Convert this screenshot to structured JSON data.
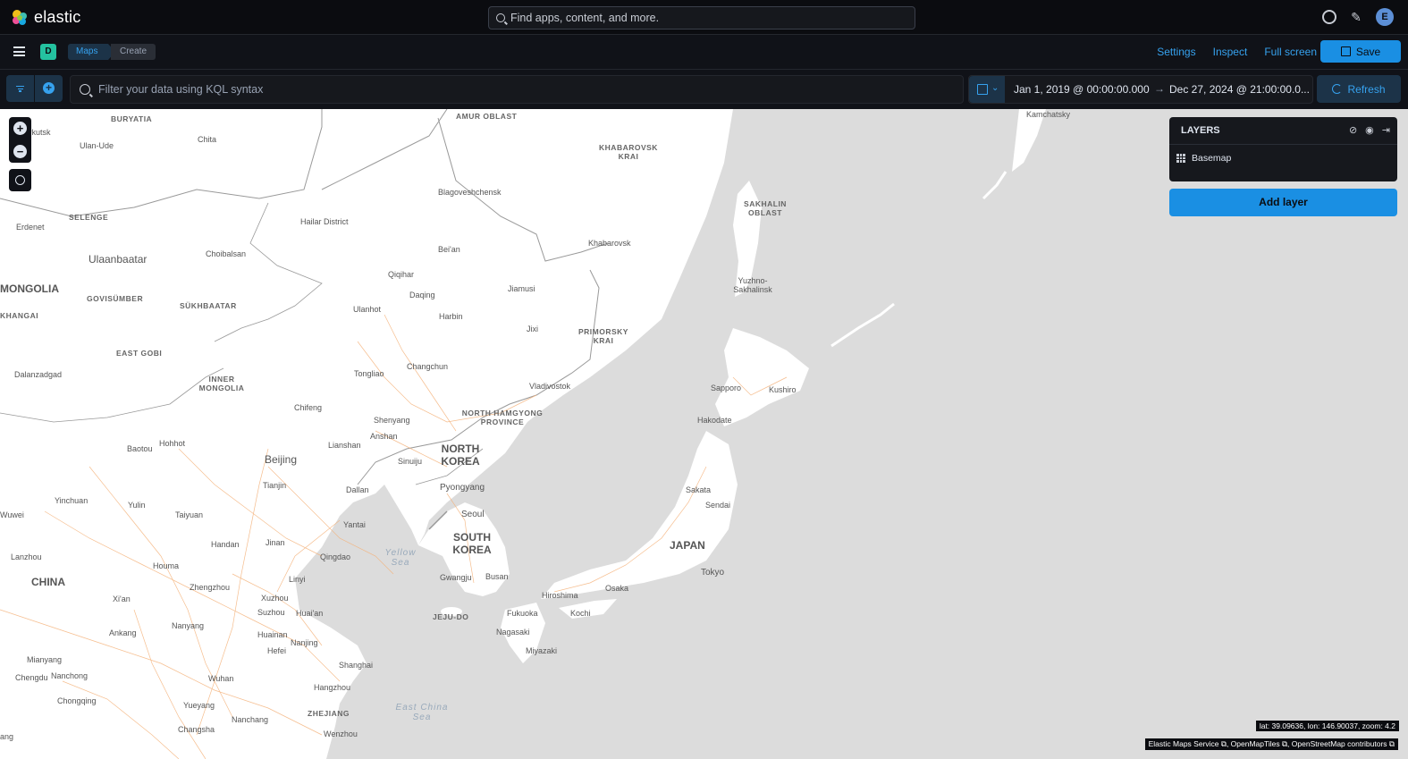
{
  "header": {
    "brand": "elastic",
    "search_placeholder": "Find apps, content, and more.",
    "avatar_letter": "E"
  },
  "appbar": {
    "space_letter": "D",
    "breadcrumbs": [
      "Maps",
      "Create"
    ],
    "links": [
      "Settings",
      "Inspect",
      "Full screen"
    ],
    "save_label": "Save"
  },
  "query": {
    "placeholder": "Filter your data using KQL syntax",
    "date_start": "Jan 1, 2019 @ 00:00:00.000",
    "date_arrow": "→",
    "date_end": "Dec 27, 2024 @ 21:00:00.0...",
    "refresh_label": "Refresh"
  },
  "layers_panel": {
    "title": "LAYERS",
    "items": [
      {
        "label": "Basemap"
      }
    ],
    "add_layer_label": "Add layer"
  },
  "map": {
    "labels": {
      "buryatia": "BURYATIA",
      "amur": "AMUR OBLAST",
      "kamchatsky": "Kamchatsky",
      "irkutsk": "Irkutsk",
      "ulanude": "Ulan-Ude",
      "chita": "Chita",
      "khabarovsk_krai": "KHABAROVSK KRAI",
      "blagoveshchensk": "Blagoveshchensk",
      "sakhalin": "SAKHALIN OBLAST",
      "selenge": "SELENGE",
      "erdenet": "Erdenet",
      "hailar": "Hailar District",
      "beian": "Bei'an",
      "khabarovsk": "Khabarovsk",
      "ulaanbaatar": "Ulaanbaatar",
      "choibalsan": "Choibalsan",
      "qiqihar": "Qiqihar",
      "yuzhno": "Yuzhno-Sakhalinsk",
      "mongolia": "MONGOLIA",
      "govisumber": "GOVISÜMBER",
      "sukhbaatar": "SÜKHBAATAR",
      "daqing": "Daqing",
      "jiamusi": "Jiamusi",
      "khangai": "KHANGAI",
      "ulanhot": "Ulanhot",
      "harbin": "Harbin",
      "jixi": "Jixi",
      "primorsky": "PRIMORSKY KRAI",
      "eastgobi": "EAST GOBI",
      "dalanzadgad": "Dalanzadgad",
      "inner_mongolia": "INNER MONGOLIA",
      "tongliao": "Tongliao",
      "changchun": "Changchun",
      "vladivostok": "Vladivostok",
      "sapporo": "Sapporo",
      "kushiro": "Kushiro",
      "chifeng": "Chifeng",
      "shenyang": "Shenyang",
      "north_hamgyong": "NORTH HAMGYONG PROVINCE",
      "hakodate": "Hakodate",
      "anshan": "Anshan",
      "baotou": "Baotou",
      "hohhot": "Hohhot",
      "lianshan": "Lianshan",
      "north_korea": "NORTH KOREA",
      "beijing": "Beijing",
      "sinuiju": "Sinuiju",
      "tianjin": "Tianjin",
      "dallan": "Dallan",
      "pyongyang": "Pyongyang",
      "sakata": "Sakata",
      "yinchuan": "Yinchuan",
      "yulin": "Yulin",
      "sendai": "Sendai",
      "wuwei": "Wuwei",
      "taiyuan": "Taiyuan",
      "seoul": "Seoul",
      "yantai": "Yantai",
      "south_korea": "SOUTH KOREA",
      "japan": "JAPAN",
      "handan": "Handan",
      "jinan": "Jinan",
      "yellow_sea": "Yellow Sea",
      "lanzhou": "Lanzhou",
      "qingdao": "Qingdao",
      "tokyo": "Tokyo",
      "houma": "Houma",
      "linyi": "Linyi",
      "gwangju": "Gwangju",
      "busan": "Busan",
      "china": "CHINA",
      "zhengzhou": "Zhengzhou",
      "hiroshima": "Hiroshima",
      "osaka": "Osaka",
      "xian": "Xi'an",
      "xuzhou": "Xuzhou",
      "suzhou": "Suzhou",
      "huaian": "Huai'an",
      "jejudo": "JEJU-DO",
      "fukuoka": "Fukuoka",
      "kochi": "Kochi",
      "nanyang": "Nanyang",
      "ankang": "Ankang",
      "nagasaki": "Nagasaki",
      "huainan": "Huainan",
      "nanjing": "Nanjing",
      "hefei": "Hefei",
      "miyazaki": "Miyazaki",
      "mianyang": "Mianyang",
      "shanghai": "Shanghai",
      "chengdu": "Chengdu",
      "nanchong": "Nanchong",
      "wuhan": "Wuhan",
      "hangzhou": "Hangzhou",
      "chongqing": "Chongqing",
      "yueyang": "Yueyang",
      "east_china_sea": "East China Sea",
      "zhejiang": "ZHEJIANG",
      "nanchang": "Nanchang",
      "changsha": "Changsha",
      "wenzhou": "Wenzhou",
      "ang": "ang"
    },
    "coords": "lat: 39.09636, lon: 146.90037, zoom: 4.2",
    "attribution": "Elastic Maps Service ⧉, OpenMapTiles ⧉, OpenStreetMap contributors ⧉"
  },
  "colors": {
    "accent": "#1a8fe3",
    "link": "#36a2ef",
    "space_badge": "#24c2a0",
    "land": "#ffffff",
    "water": "#dcdcdc",
    "roads": "#f4b27a"
  }
}
